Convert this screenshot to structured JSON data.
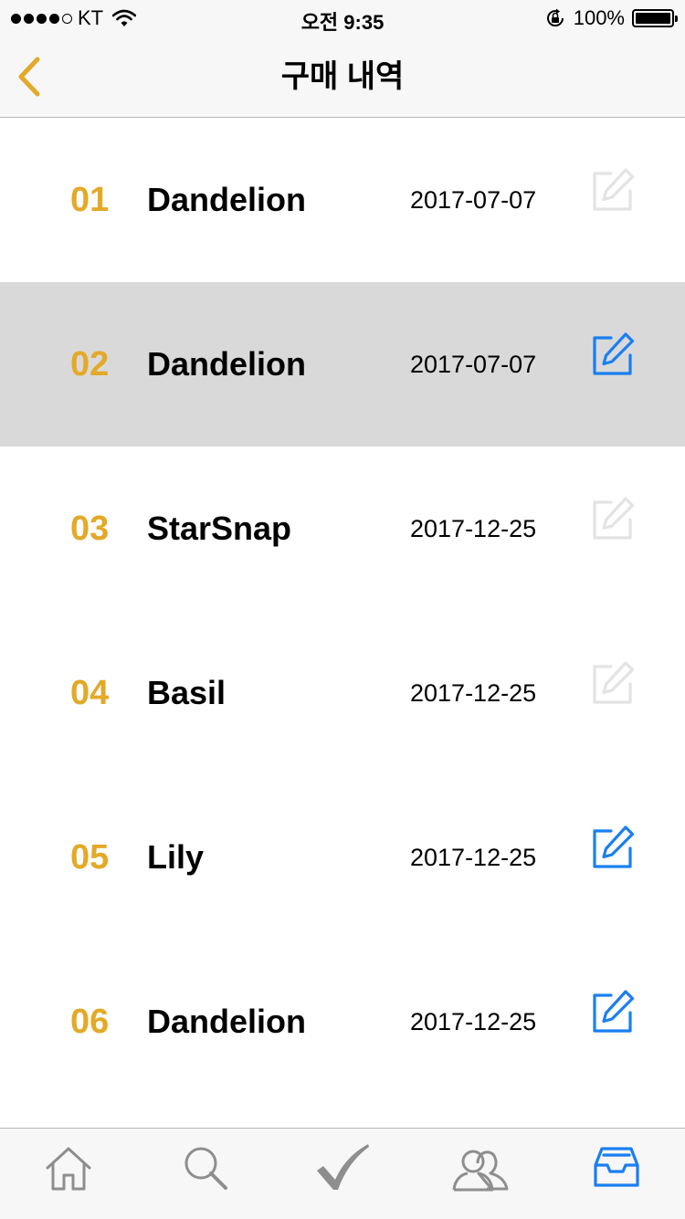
{
  "status_bar": {
    "carrier": "KT",
    "time": "오전 9:35",
    "battery_text": "100%",
    "signal_strength": 4,
    "signal_max": 5,
    "battery_level": 1.0
  },
  "nav": {
    "title": "구매 내역",
    "back_icon": "chevron-left-icon"
  },
  "purchases": [
    {
      "number": "01",
      "name": "Dandelion",
      "date": "2017-07-07",
      "edit_enabled": false,
      "selected": false
    },
    {
      "number": "02",
      "name": "Dandelion",
      "date": "2017-07-07",
      "edit_enabled": true,
      "selected": true
    },
    {
      "number": "03",
      "name": "StarSnap",
      "date": "2017-12-25",
      "edit_enabled": false,
      "selected": false
    },
    {
      "number": "04",
      "name": "Basil",
      "date": "2017-12-25",
      "edit_enabled": false,
      "selected": false
    },
    {
      "number": "05",
      "name": "Lily",
      "date": "2017-12-25",
      "edit_enabled": true,
      "selected": false
    },
    {
      "number": "06",
      "name": "Dandelion",
      "date": "2017-12-25",
      "edit_enabled": true,
      "selected": false
    }
  ],
  "tabs": [
    {
      "icon": "home-icon",
      "active": false
    },
    {
      "icon": "search-icon",
      "active": false
    },
    {
      "icon": "checkmark-icon",
      "active": false
    },
    {
      "icon": "people-icon",
      "active": false
    },
    {
      "icon": "inbox-icon",
      "active": true
    }
  ],
  "colors": {
    "accent": "#e3a928",
    "edit_active": "#1a7ff0",
    "edit_disabled": "#e3e3e3",
    "tab_inactive": "#8e8e8e",
    "tab_active": "#1a7ff0",
    "selected_row": "#d9d9d9"
  }
}
